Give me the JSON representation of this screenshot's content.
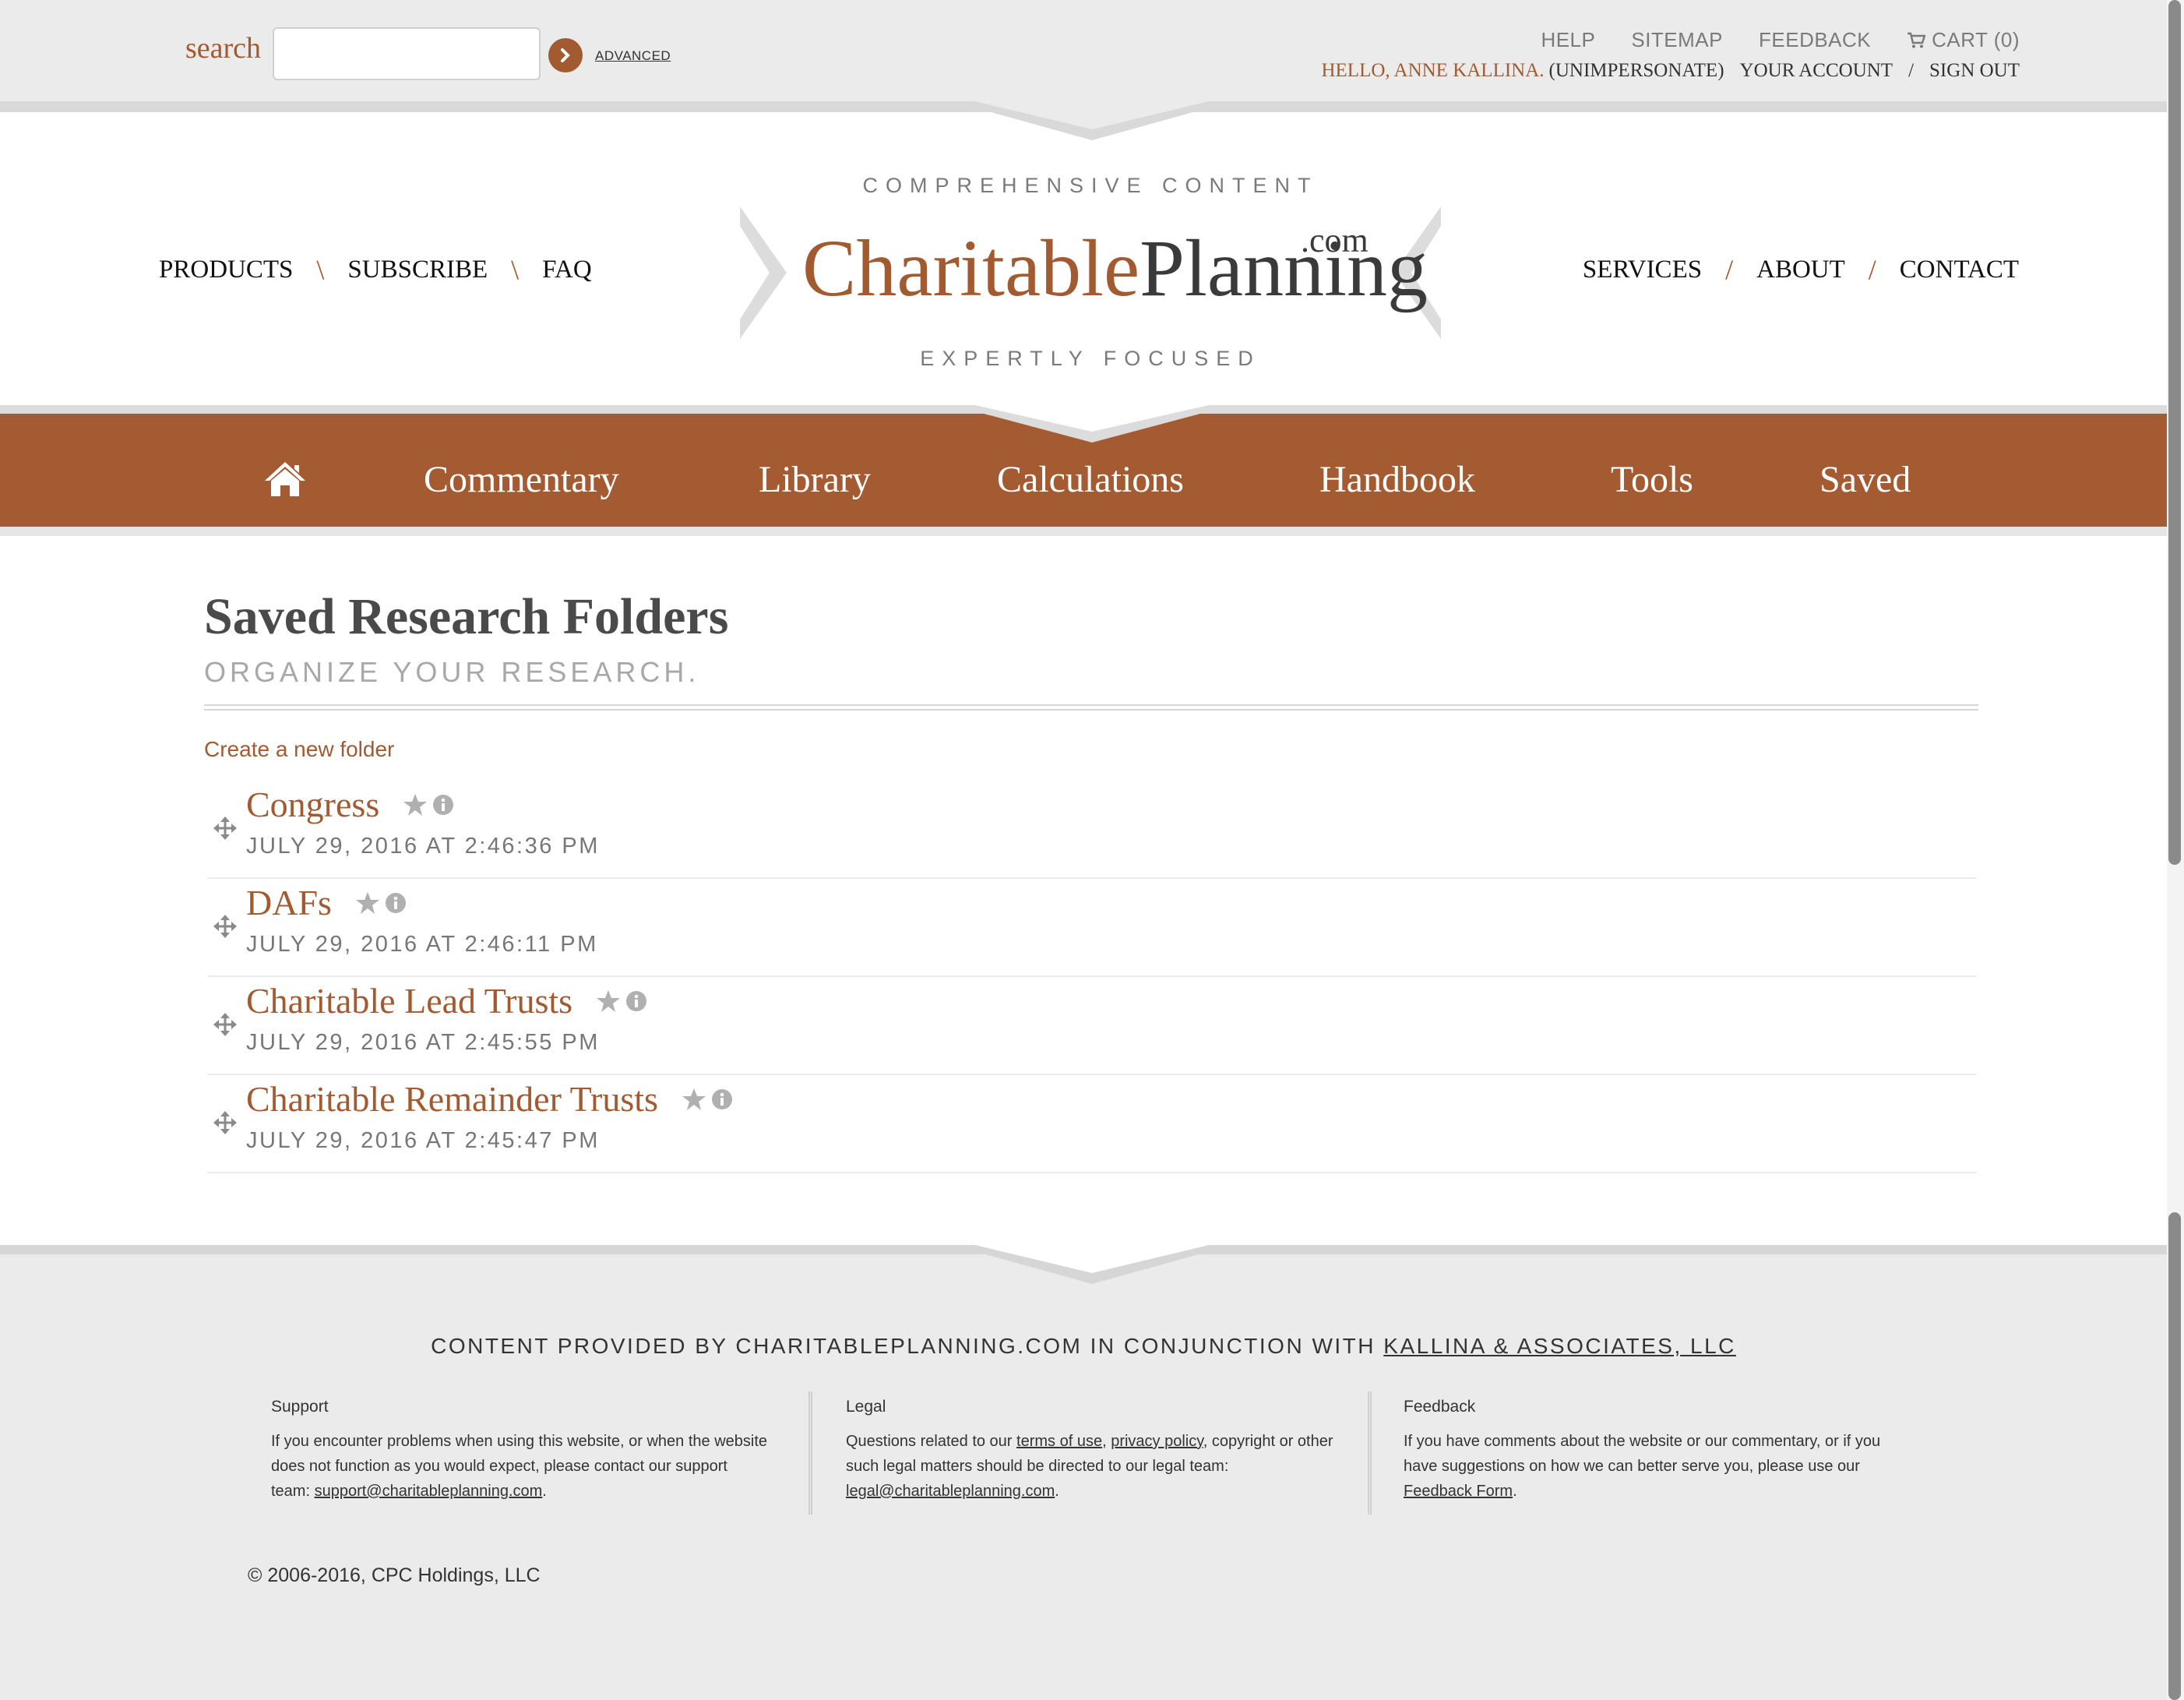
{
  "topbar": {
    "search_label": "search",
    "search_value": "",
    "advanced": "ADVANCED",
    "links": [
      "HELP",
      "SITEMAP",
      "FEEDBACK",
      "CART (0)"
    ],
    "hello": "HELLO, ANNE KALLINA.",
    "unimpersonate": "(UNIMPERSONATE)",
    "your_account": "YOUR ACCOUNT",
    "slash": "/",
    "sign_out": "SIGN OUT"
  },
  "header": {
    "left_nav": [
      "PRODUCTS",
      "SUBSCRIBE",
      "FAQ"
    ],
    "left_sep": "\\",
    "right_nav": [
      "SERVICES",
      "ABOUT",
      "CONTACT"
    ],
    "right_sep": "/",
    "logo_top": "COMPREHENSIVE CONTENT",
    "logo_part1": "Charitable",
    "logo_part2": "Planning",
    "logo_com": ".com",
    "logo_bottom": "EXPERTLY FOCUSED"
  },
  "mainnav": {
    "items": [
      "Commentary",
      "Library",
      "Calculations",
      "Handbook",
      "Tools",
      "Saved"
    ]
  },
  "content": {
    "title": "Saved Research Folders",
    "subtitle": "ORGANIZE YOUR RESEARCH.",
    "create_link": "Create a new folder",
    "folders": [
      {
        "name": "Congress",
        "date": "JULY 29, 2016 AT 2:46:36 PM"
      },
      {
        "name": "DAFs",
        "date": "JULY 29, 2016 AT 2:46:11 PM"
      },
      {
        "name": "Charitable Lead Trusts",
        "date": "JULY 29, 2016 AT 2:45:55 PM"
      },
      {
        "name": "Charitable Remainder Trusts",
        "date": "JULY 29, 2016 AT 2:45:47 PM"
      }
    ]
  },
  "footer": {
    "credit_prefix": "CONTENT PROVIDED BY CHARITABLEPLANNING.COM IN CONJUNCTION WITH",
    "credit_link": "KALLINA & ASSOCIATES, LLC",
    "support": {
      "heading": "Support",
      "text": "If you encounter problems when using this website, or when the website does not function as you would expect, please contact our support team:",
      "email": "support@charitableplanning.com",
      "end": "."
    },
    "legal": {
      "heading": "Legal",
      "text1": "Questions related to our",
      "terms": "terms of use",
      "comma": ",",
      "privacy": "privacy policy",
      "text2": ", copyright or other such legal matters should be directed to our legal team:",
      "email": "legal@charitableplanning.com",
      "end": "."
    },
    "feedback": {
      "heading": "Feedback",
      "text": "If you have comments about the website or our commentary, or if you have suggestions on how we can better serve you, please use our",
      "link": "Feedback Form",
      "end": "."
    },
    "copyright": "© 2006-2016, CPC Holdings, LLC"
  },
  "colors": {
    "accent": "#a45b32",
    "topbar_bg": "#ebebeb"
  }
}
